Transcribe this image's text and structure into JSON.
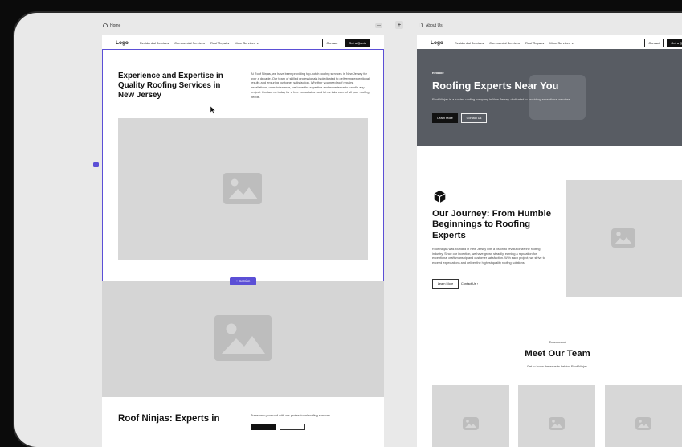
{
  "left_page": {
    "tab_label": "Home",
    "nav": {
      "logo": "Logo",
      "links": [
        "Residential Services",
        "Commercial Services",
        "Roof Repairs",
        "More Services"
      ],
      "contact": "Contact",
      "cta": "Get a Quote"
    },
    "hero": {
      "title": "Experience and Expertise in Quality Roofing Services in New Jersey",
      "paragraph": "At Roof Ninjas, we have been providing top-notch roofing services in New Jersey for over a decade. Our team of skilled professionals is dedicated to delivering exceptional results and ensuring customer satisfaction. Whether you need roof repairs, installations, or maintenance, we have the expertise and experience to handle any project. Contact us today for a free consultation and let us take care of all your roofing needs."
    },
    "section_badge": "+ Section",
    "bottom": {
      "title": "Roof Ninjas: Experts in",
      "subtext": "Transform your roof with our professional roofing services."
    }
  },
  "right_page": {
    "tab_label": "About Us",
    "nav": {
      "logo": "Logo",
      "links": [
        "Residential Services",
        "Commercial Services",
        "Roof Repairs",
        "More Services"
      ],
      "contact": "Contact",
      "cta": "Get a Quote"
    },
    "hero": {
      "tagline": "Reliable",
      "title": "Roofing Experts Near You",
      "paragraph": "Roof Ninjas is a trusted roofing company in New Jersey, dedicated to providing exceptional services.",
      "learn_more": "Learn More",
      "contact_us": "Contact Us"
    },
    "journey": {
      "title": "Our Journey: From Humble Beginnings to Roofing Experts",
      "paragraph": "Roof Ninjas was founded in New Jersey with a vision to revolutionize the roofing industry. Since our inception, we have grown steadily, earning a reputation for exceptional craftsmanship and customer satisfaction. With each project, we strive to exceed expectations and deliver the highest quality roofing solutions.",
      "learn_more": "Learn More",
      "contact_us": "Contact Us"
    },
    "team": {
      "tagline": "Experienced",
      "title": "Meet Our Team",
      "subtitle": "Get to know the experts behind Roof Ninjas."
    }
  },
  "toolbar": {
    "add_symbol": "+",
    "minimize_symbol": "—"
  },
  "colors": {
    "selection": "#5b4fd6",
    "hero_bg": "#585c63",
    "dark": "#111111",
    "placeholder": "#d7d7d7"
  }
}
